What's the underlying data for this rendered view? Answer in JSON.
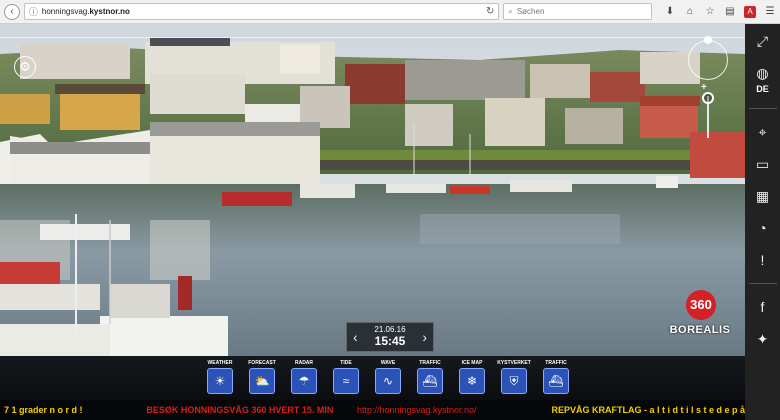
{
  "browser": {
    "url_prefix": "honningsvag.",
    "url_domain": "kystnor.no",
    "search_placeholder": "Søchen",
    "icons": [
      "back-icon",
      "info-icon",
      "reload-icon",
      "search-icon",
      "download-icon",
      "home-icon",
      "bookmark-icon",
      "reader-icon",
      "addon-icon",
      "menu-icon"
    ]
  },
  "webcam": {
    "date": "21.06.16",
    "time": "15:45",
    "logo_number": "360",
    "logo_name": "BOREALIS"
  },
  "sidebar": {
    "language": "DE",
    "icons": [
      "fullscreen-icon",
      "globe-icon",
      "location-pin-icon",
      "display-icon",
      "calendar-icon",
      "daylight-icon",
      "alert-icon",
      "facebook-icon",
      "twitter-icon"
    ]
  },
  "tiles": [
    {
      "label": "WEATHER",
      "icon": "weather-icon"
    },
    {
      "label": "FORECAST",
      "icon": "forecast-icon"
    },
    {
      "label": "RADAR",
      "icon": "radar-icon"
    },
    {
      "label": "TIDE",
      "icon": "tide-icon"
    },
    {
      "label": "WAVE",
      "icon": "wave-icon"
    },
    {
      "label": "TRAFFIC",
      "icon": "ais-traffic-icon"
    },
    {
      "label": "ICE MAP",
      "icon": "ice-map-icon"
    },
    {
      "label": "KYSTVERKET",
      "icon": "kystverket-icon"
    },
    {
      "label": "TRAFFIC",
      "icon": "ais-traffic-icon"
    }
  ],
  "ticker": {
    "t1": "7 1 grader n o r d !",
    "t2": "BESØK HONNINGSVÅG 360 HVERT 15. MIN",
    "t3": "http://honningsvag.kystnor.no/",
    "t4": "REPVÅG KRAFTLAG - a l t i d  t i l s t e d e  p å"
  },
  "colors": {
    "tile_blue": "#2b52b7",
    "ticker_yellow": "#f3d000",
    "ticker_red": "#d4201e",
    "logo_red": "#d62028"
  }
}
